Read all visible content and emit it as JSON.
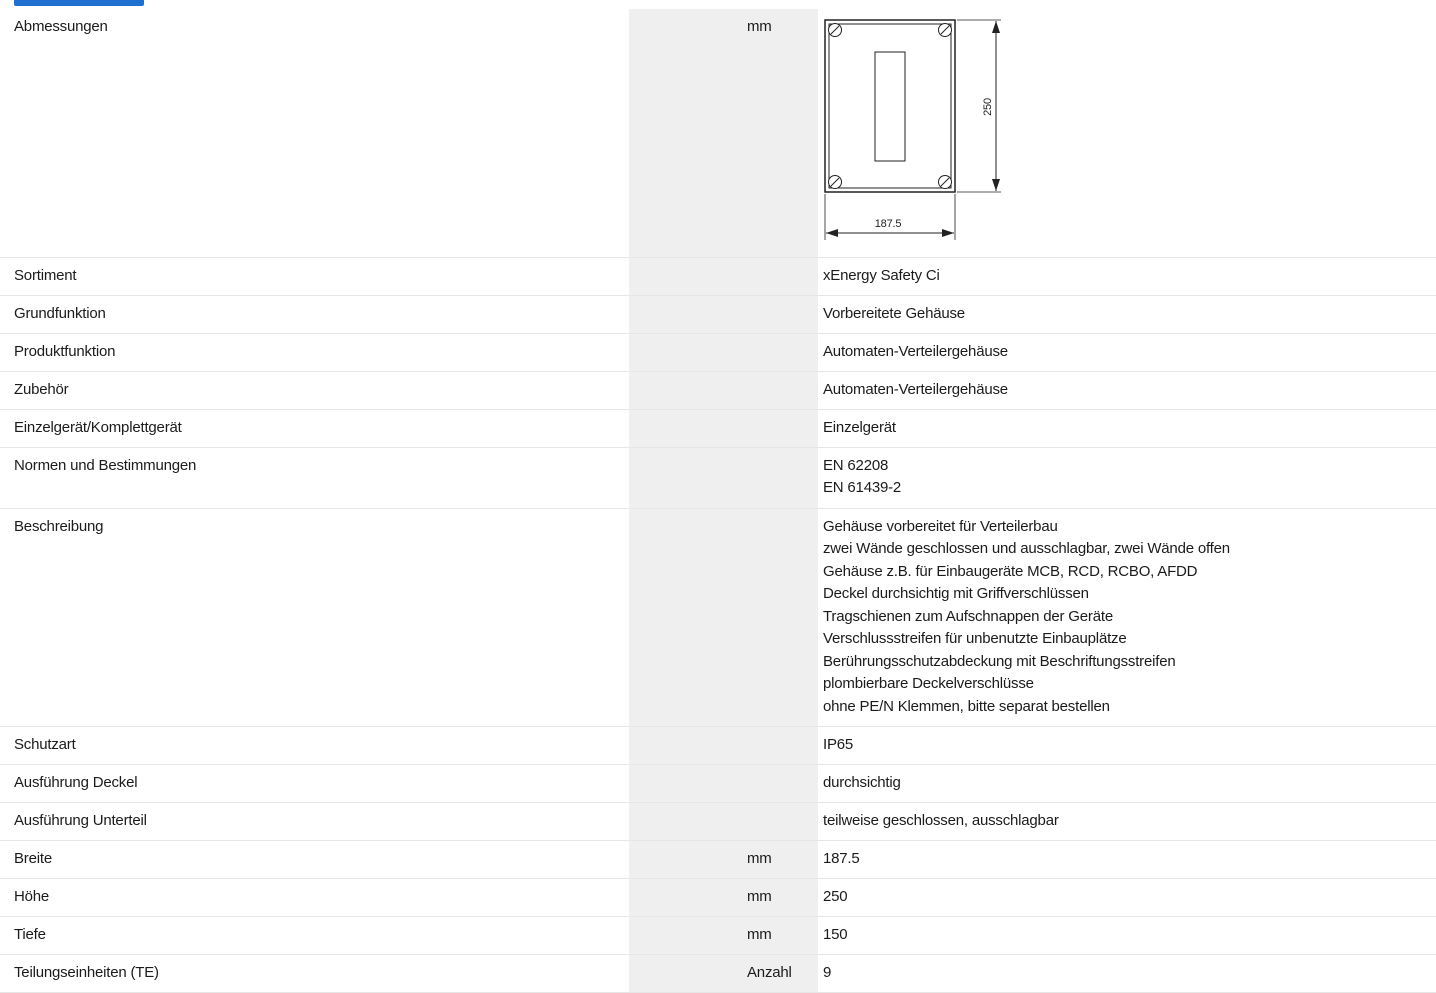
{
  "rows": [
    {
      "label": "Abmessungen",
      "unit": "mm",
      "values": [],
      "drawing": {
        "height_dim": "250",
        "width_dim": "187.5"
      }
    },
    {
      "label": "Sortiment",
      "unit": "",
      "values": [
        "xEnergy Safety Ci"
      ]
    },
    {
      "label": "Grundfunktion",
      "unit": "",
      "values": [
        "Vorbereitete Gehäuse"
      ]
    },
    {
      "label": "Produktfunktion",
      "unit": "",
      "values": [
        "Automaten-Verteilergehäuse"
      ]
    },
    {
      "label": "Zubehör",
      "unit": "",
      "values": [
        "Automaten-Verteilergehäuse"
      ]
    },
    {
      "label": "Einzelgerät/Komplettgerät",
      "unit": "",
      "values": [
        "Einzelgerät"
      ]
    },
    {
      "label": "Normen und Bestimmungen",
      "unit": "",
      "values": [
        "EN 62208",
        "EN 61439-2"
      ]
    },
    {
      "label": "Beschreibung",
      "unit": "",
      "values": [
        "Gehäuse vorbereitet für Verteilerbau",
        "zwei Wände geschlossen und ausschlagbar, zwei Wände offen",
        "Gehäuse z.B. für Einbaugeräte MCB, RCD, RCBO, AFDD",
        "Deckel durchsichtig mit Griffverschlüssen",
        "Tragschienen zum Aufschnappen der Geräte",
        "Verschlussstreifen für unbenutzte Einbauplätze",
        "Berührungsschutzabdeckung mit Beschriftungsstreifen",
        "plombierbare Deckelverschlüsse",
        "ohne PE/N Klemmen, bitte separat bestellen"
      ]
    },
    {
      "label": "Schutzart",
      "unit": "",
      "values": [
        "IP65"
      ]
    },
    {
      "label": "Ausführung Deckel",
      "unit": "",
      "values": [
        "durchsichtig"
      ]
    },
    {
      "label": "Ausführung Unterteil",
      "unit": "",
      "values": [
        "teilweise geschlossen, ausschlagbar"
      ]
    },
    {
      "label": "Breite",
      "unit": "mm",
      "values": [
        "187.5"
      ]
    },
    {
      "label": "Höhe",
      "unit": "mm",
      "values": [
        "250"
      ]
    },
    {
      "label": "Tiefe",
      "unit": "mm",
      "values": [
        "150"
      ]
    },
    {
      "label": "Teilungseinheiten (TE)",
      "unit": "Anzahl",
      "values": [
        "9"
      ]
    }
  ]
}
